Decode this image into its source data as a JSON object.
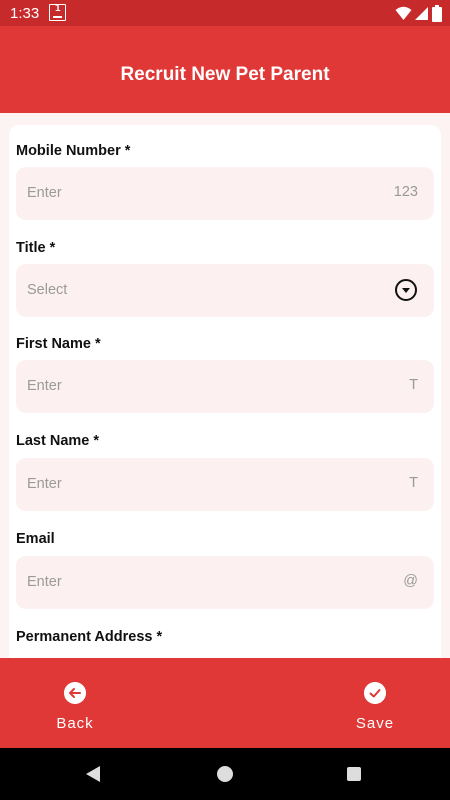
{
  "status_bar": {
    "time": "1:33",
    "notif_digit": "1"
  },
  "header": {
    "title": "Recruit New Pet Parent"
  },
  "form": {
    "fields": [
      {
        "label": "Mobile Number *",
        "placeholder": "Enter",
        "icon": "123",
        "icon_name": "numeric-icon"
      },
      {
        "label": "Title *",
        "placeholder": "Select",
        "icon_name": "dropdown-icon"
      },
      {
        "label": "First Name *",
        "placeholder": "Enter",
        "icon": "T",
        "icon_name": "text-icon"
      },
      {
        "label": "Last Name *",
        "placeholder": "Enter",
        "icon": "T",
        "icon_name": "text-icon"
      },
      {
        "label": "Email",
        "placeholder": "Enter",
        "icon": "@",
        "icon_name": "at-icon"
      },
      {
        "label": "Permanent Address *"
      }
    ]
  },
  "actions": {
    "back_label": "Back",
    "save_label": "Save"
  },
  "colors": {
    "primary": "#e03836",
    "status_bar": "#c62a2a",
    "field_bg": "#fcf0f0",
    "page_bg": "#fdf3f3"
  }
}
